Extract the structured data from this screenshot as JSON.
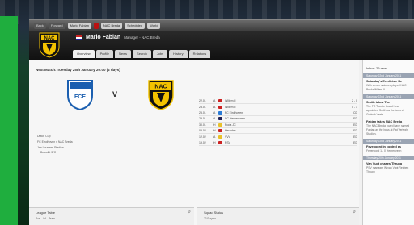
{
  "topbar": {
    "buttons": [
      "Back",
      "Forward",
      "Home",
      "NAC Breda",
      "Scheduled",
      "World",
      "Continue"
    ],
    "manager_btn": "Mario Fabian"
  },
  "header": {
    "club_short": "NAC",
    "manager_name": "Mario Fabian",
    "manager_role": "Manager - NAC Breda",
    "tabs": [
      "Overview",
      "Profile",
      "News",
      "Search",
      "Jobs",
      "History",
      "Relations"
    ]
  },
  "next_match": {
    "title": "Next Match: Tuesday 25th January 20:00 (2 days)",
    "vs": "V",
    "home": "FCE",
    "away": "NAC",
    "competition": "Dutch Cup",
    "fixture": "FC Eindhoven v NAC Breda",
    "stadium": "Jan Louwers Stadion",
    "weather": "Bewolkt 3°C"
  },
  "fixtures": [
    {
      "date": "22.01",
      "venue": "A",
      "opponent": "Willem II",
      "score": "2 - 0",
      "color": "#c22"
    },
    {
      "date": "23.01",
      "venue": "A",
      "opponent": "Willem II",
      "score": "0 - 1",
      "color": "#c22"
    },
    {
      "date": "25.01",
      "venue": "A",
      "opponent": "FC Eindhoven",
      "score": "CD",
      "color": "#2a7bd6"
    },
    {
      "date": "29.01",
      "venue": "A",
      "opponent": "SC Heerenveen",
      "score": "ED",
      "color": "#225"
    },
    {
      "date": "30.01",
      "venue": "H",
      "opponent": "Roda JC",
      "score": "ED",
      "color": "#e8c12a"
    },
    {
      "date": "05.02",
      "venue": "H",
      "opponent": "Heracles",
      "score": "ED",
      "color": "#c22"
    },
    {
      "date": "12.02",
      "venue": "A",
      "opponent": "VVV",
      "score": "ED",
      "color": "#e8c12a"
    },
    {
      "date": "19.02",
      "venue": "H",
      "opponent": "PSV",
      "score": "ED",
      "color": "#c22"
    }
  ],
  "fixture_buttons": [
    "Competition",
    "Club Fixtures"
  ],
  "inbox": {
    "title": "Inbox: 29 new",
    "groups": [
      {
        "day": "Saturday 22nd January 2011",
        "title": "Saturday's Eredivisie Re",
        "text": "With seven matches played NAC Breda/Willem II"
      },
      {
        "day": "Saturday 22nd January 2011",
        "title": "Smith takes The",
        "text": "The FC Twente board have appointed Smith as the boss at Grolsch Veste."
      },
      {
        "day": "",
        "title": "Fabian takes NAC Breda",
        "text": "The NAC Breda board have named Fabian as the boss at Rat Verlegh Stadion."
      },
      {
        "day": "Saturday 22nd January 2011",
        "title": "Feyenoord in control as",
        "text": "Feyenoord 1 - 0 Heerenveen"
      },
      {
        "day": "Thursday 20th January 2011",
        "title": "Van Vugt chases Thrupp",
        "text": "PSV manager W van Vugt Reuben Thrupp"
      }
    ]
  },
  "bottom": {
    "league_title": "League Table",
    "league_cols": [
      "Pos",
      "Inf",
      "Team"
    ],
    "squad_title": "Squad Status",
    "squad_rows": [
      "23 Players",
      "7 Players"
    ]
  }
}
